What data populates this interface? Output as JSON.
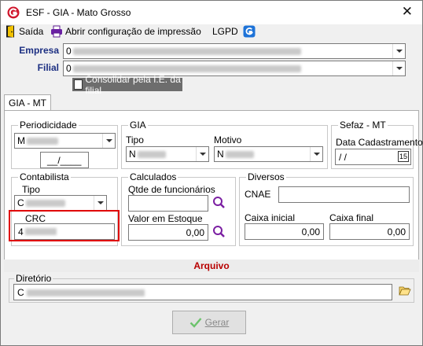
{
  "window": {
    "title": "ESF - GIA - Mato Grosso",
    "close_glyph": "✕"
  },
  "toolbar": {
    "saida": "Saída",
    "abrir_config": "Abrir configuração de impressão",
    "lgpd": "LGPD"
  },
  "form": {
    "empresa_label": "Empresa",
    "empresa_value": "0",
    "filial_label": "Filial",
    "filial_value": "0",
    "consolidar_label": "Consolidar pela I.E. da filial"
  },
  "tab": {
    "label": "GIA - MT"
  },
  "periodicidade": {
    "title": "Periodicidade",
    "value": "M",
    "date": "__/____"
  },
  "gia": {
    "title": "GIA",
    "tipo_label": "Tipo",
    "tipo_value": "N",
    "motivo_label": "Motivo",
    "motivo_value": "N"
  },
  "sefaz": {
    "title": "Sefaz - MT",
    "data_label": "Data Cadastramento",
    "data_value": " /  /",
    "calendar_label": "15"
  },
  "contabilista": {
    "title": "Contabilista",
    "tipo_label": "Tipo",
    "tipo_value": "C",
    "crc_label": "CRC",
    "crc_value": "4"
  },
  "calculados": {
    "title": "Calculados",
    "qtde_label": "Qtde de funcionários",
    "valor_label": "Valor em Estoque",
    "valor_value": "0,00"
  },
  "diversos": {
    "title": "Diversos",
    "cnae_label": "CNAE",
    "caixa_inicial_label": "Caixa inicial",
    "caixa_inicial_value": "0,00",
    "caixa_final_label": "Caixa final",
    "caixa_final_value": "0,00"
  },
  "arquivo": {
    "title": "Arquivo",
    "diretorio_label": "Diretório",
    "diretorio_value": "C"
  },
  "actions": {
    "gerar": "Gerar"
  },
  "colors": {
    "accent_red": "#b80000",
    "label_blue": "#1c2f82",
    "highlight": "#e00000"
  }
}
